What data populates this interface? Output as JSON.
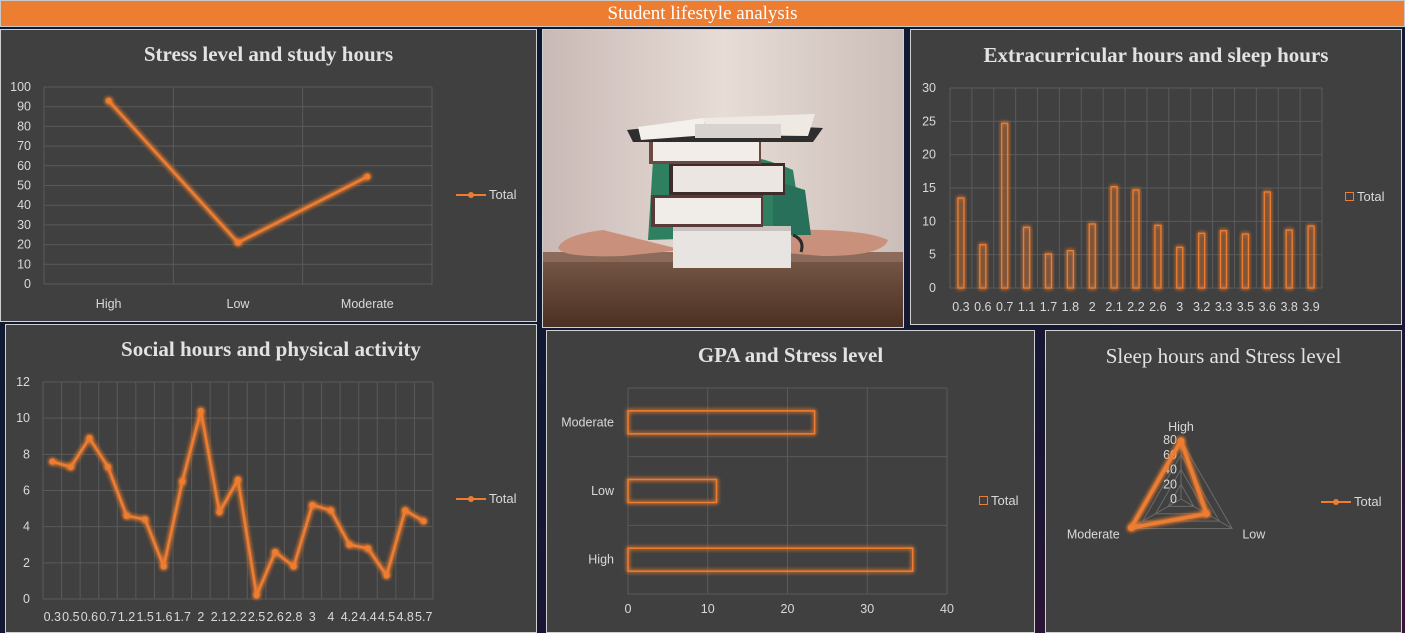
{
  "dashboard_title": "Student lifestyle analysis",
  "legend_label": "Total",
  "accent_color": "#ed7d31",
  "panel_color": "#404040",
  "photo_icon": "student-behind-book-stack-photo",
  "chart_data": [
    {
      "id": "stress_study",
      "type": "line",
      "title": "Stress level and study hours",
      "categories": [
        "High",
        "Low",
        "Moderate"
      ],
      "series": [
        {
          "name": "Total",
          "values": [
            93,
            21,
            54.5
          ]
        }
      ],
      "ylim": [
        0,
        100
      ],
      "yticks": [
        0,
        10,
        20,
        30,
        40,
        50,
        60,
        70,
        80,
        90,
        100
      ],
      "grid": true,
      "legend": "right"
    },
    {
      "id": "extra_sleep",
      "type": "bar",
      "title": "Extracurricular hours and sleep hours",
      "categories": [
        "0.3",
        "0.6",
        "0.7",
        "1.1",
        "1.7",
        "1.8",
        "2",
        "2.1",
        "2.2",
        "2.6",
        "3",
        "3.2",
        "3.3",
        "3.5",
        "3.6",
        "3.8",
        "3.9"
      ],
      "series": [
        {
          "name": "Total",
          "values": [
            13.5,
            6.5,
            24.7,
            9.1,
            5.1,
            5.6,
            9.6,
            15.2,
            14.7,
            9.4,
            6.1,
            8.2,
            8.6,
            8.1,
            14.4,
            8.7,
            9.3
          ]
        }
      ],
      "ylim": [
        0,
        30
      ],
      "yticks": [
        0,
        5,
        10,
        15,
        20,
        25,
        30
      ],
      "grid": true,
      "legend": "right"
    },
    {
      "id": "social_physical",
      "type": "line",
      "title": "Social hours and physical activity",
      "categories": [
        "0.3",
        "0.5",
        "0.6",
        "0.7",
        "1.2",
        "1.5",
        "1.6",
        "1.7",
        "2",
        "2.1",
        "2.2",
        "2.5",
        "2.6",
        "2.8",
        "3",
        "4",
        "4.2",
        "4.4",
        "4.5",
        "4.8",
        "5.7"
      ],
      "category_labels": [
        "0.3",
        "0.5",
        "0.6",
        "0.7",
        "1.2",
        "1.5",
        "1.6",
        "1.7",
        "2",
        "2.1",
        "2.2",
        "2.5",
        "2.6",
        "2.8",
        "3",
        "4",
        "4.2",
        "4.4",
        "4.5",
        "4.8",
        "5.7"
      ],
      "series": [
        {
          "name": "Total",
          "values": [
            7.6,
            7.3,
            8.9,
            7.3,
            4.6,
            4.4,
            1.8,
            6.5,
            10.4,
            4.8,
            6.6,
            0.2,
            2.6,
            1.8,
            5.2,
            4.9,
            3.0,
            2.8,
            1.3,
            4.9,
            4.3
          ]
        }
      ],
      "ylim": [
        0,
        12
      ],
      "yticks": [
        0,
        2,
        4,
        6,
        8,
        10,
        12
      ],
      "grid": true,
      "legend": "right"
    },
    {
      "id": "gpa_stress",
      "type": "bar",
      "orientation": "horizontal",
      "title": "GPA and Stress level",
      "categories": [
        "High",
        "Low",
        "Moderate"
      ],
      "series": [
        {
          "name": "Total",
          "values": [
            35.7,
            11.1,
            23.4
          ]
        }
      ],
      "xlim": [
        0,
        40
      ],
      "xticks": [
        0,
        10,
        20,
        30,
        40
      ],
      "grid": true,
      "legend": "right"
    },
    {
      "id": "sleep_stress",
      "type": "radar",
      "title": "Sleep hours and Stress level",
      "categories": [
        "High",
        "Low",
        "Moderate"
      ],
      "series": [
        {
          "name": "Total",
          "values": [
            79,
            40,
            78
          ]
        }
      ],
      "rlim": [
        0,
        80
      ],
      "rticks": [
        0,
        20,
        40,
        60,
        80
      ],
      "legend": "right"
    }
  ]
}
